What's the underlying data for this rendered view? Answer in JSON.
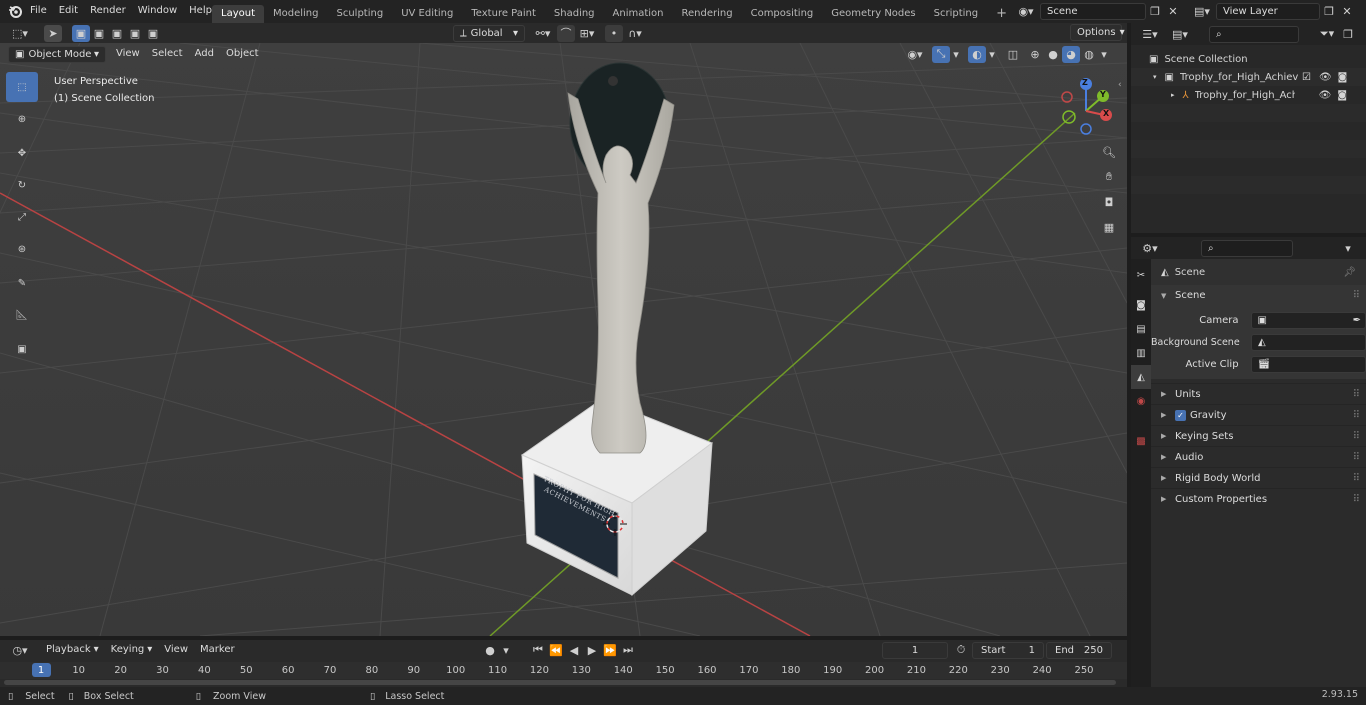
{
  "menus": [
    "File",
    "Edit",
    "Render",
    "Window",
    "Help"
  ],
  "workspaces": [
    "Layout",
    "Modeling",
    "Sculpting",
    "UV Editing",
    "Texture Paint",
    "Shading",
    "Animation",
    "Rendering",
    "Compositing",
    "Geometry Nodes",
    "Scripting"
  ],
  "scene_field": "Scene",
  "view_layer_field": "View Layer",
  "viewport": {
    "mode": "Object Mode",
    "menus": [
      "View",
      "Select",
      "Add",
      "Object"
    ],
    "transform_orientation": "Global",
    "options_label": "Options",
    "overlay_line1": "User Perspective",
    "overlay_line2": "(1) Scene Collection",
    "plaque_text": "TROPHY FOR HIGH ACHIEVEMENTS",
    "gizmo": {
      "z": "Z",
      "y": "Y",
      "x": "X"
    }
  },
  "outliner": {
    "root": "Scene Collection",
    "items": [
      {
        "label": "Trophy_for_High_Achievemer"
      },
      {
        "label": "Trophy_for_High_Achieve"
      }
    ]
  },
  "properties": {
    "breadcrumb": "Scene",
    "section": "Scene",
    "fields": [
      {
        "label": "Camera"
      },
      {
        "label": "Background Scene"
      },
      {
        "label": "Active Clip"
      }
    ],
    "panels": [
      "Units",
      "Gravity",
      "Keying Sets",
      "Audio",
      "Rigid Body World",
      "Custom Properties"
    ]
  },
  "timeline": {
    "menus": [
      "Playback",
      "Keying",
      "View",
      "Marker"
    ],
    "current_frame": "1",
    "start_label": "Start",
    "start": "1",
    "end_label": "End",
    "end": "250",
    "ticks": [
      "1",
      "10",
      "20",
      "30",
      "40",
      "50",
      "60",
      "70",
      "80",
      "90",
      "100",
      "110",
      "120",
      "130",
      "140",
      "150",
      "160",
      "170",
      "180",
      "190",
      "200",
      "210",
      "220",
      "230",
      "240",
      "250"
    ]
  },
  "status": {
    "select": "Select",
    "box_select": "Box Select",
    "zoom_view": "Zoom View",
    "lasso_select": "Lasso Select",
    "version": "2.93.15"
  },
  "colors": {
    "accent": "#4772b3",
    "x_axis": "#c04040",
    "y_axis": "#7aa02a"
  }
}
